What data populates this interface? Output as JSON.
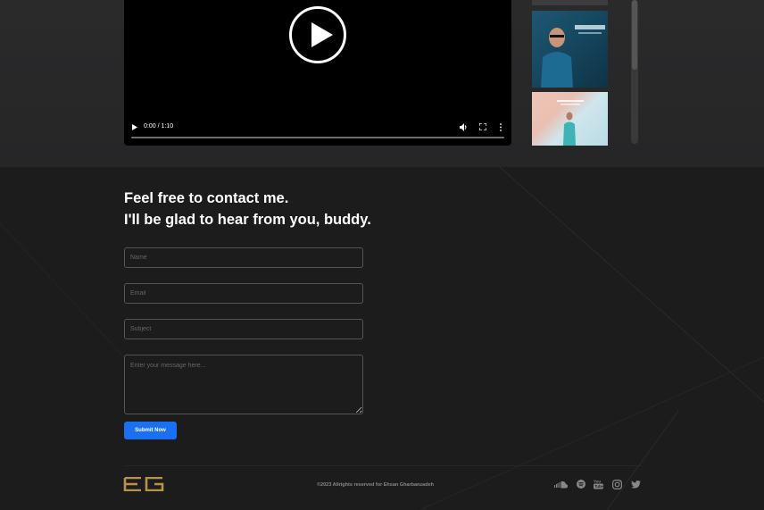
{
  "video": {
    "time": "0:00 / 1:10",
    "icons": [
      "play-icon",
      "volume-icon",
      "fullscreen-icon",
      "more-options-icon"
    ]
  },
  "contact": {
    "heading_line1": "Feel free to contact me.",
    "heading_line2": "I'll be glad to hear from you, buddy.",
    "name_placeholder": "Name",
    "email_placeholder": "Email",
    "subject_placeholder": "Subject",
    "message_placeholder": "Enter your message here...",
    "submit_label": "Submit Now"
  },
  "footer": {
    "logo": "EG",
    "copyright": "©2023 Allrights reserved for Ehsan Gharbanzadeh",
    "social_icons": [
      "soundcloud-icon",
      "spotify-icon",
      "youtube-icon",
      "instagram-icon",
      "twitter-icon"
    ]
  },
  "colors": {
    "accent": "#1a6ff3",
    "logo": "#b89248",
    "background": "#1c1c1d"
  }
}
